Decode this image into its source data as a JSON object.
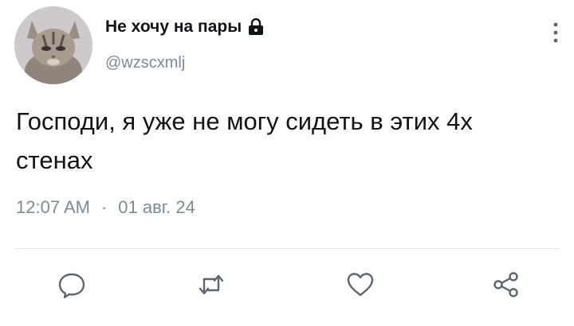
{
  "user": {
    "display_name": "Не хочу на пары",
    "handle": "@wzscxmlj",
    "protected_icon": "lock-icon",
    "avatar": "cat-avatar"
  },
  "tweet": {
    "text": "Господи, я уже не могу сидеть в этих 4х стенах",
    "time": "12:07 AM",
    "separator": "·",
    "date": "01 авг. 24"
  },
  "actions": [
    {
      "name": "reply",
      "icon": "comment-icon"
    },
    {
      "name": "retweet",
      "icon": "retweet-icon"
    },
    {
      "name": "like",
      "icon": "heart-icon"
    },
    {
      "name": "share",
      "icon": "share-icon"
    }
  ],
  "colors": {
    "text": "#0f1419",
    "secondary": "#7b8b98",
    "divider": "#e3e8ec"
  }
}
